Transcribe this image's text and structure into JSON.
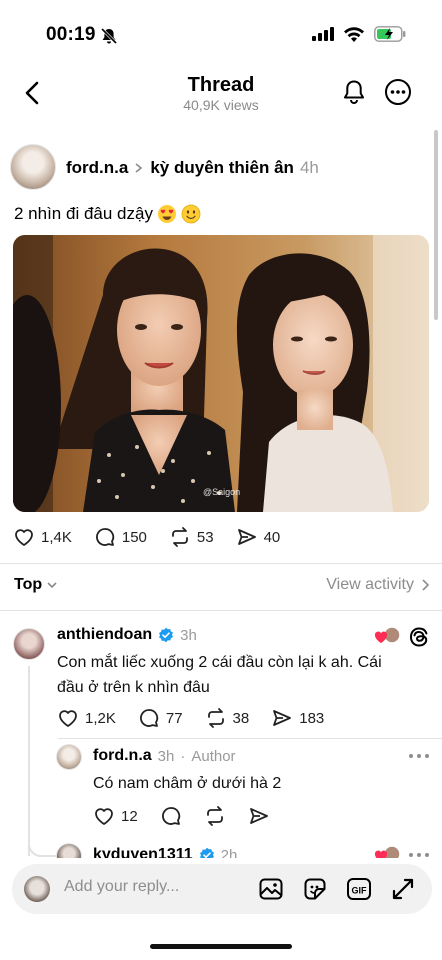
{
  "status": {
    "time": "00:19"
  },
  "header": {
    "title": "Thread",
    "views": "40,9K views"
  },
  "post": {
    "username": "ford.n.a",
    "reply_to": "kỳ duyên thiên ân",
    "time": "4h",
    "text": "2 nhìn đi đâu dzậy",
    "image_watermark": "@Saigon",
    "likes": "1,4K",
    "comments": "150",
    "reposts": "53",
    "shares": "40"
  },
  "sort": {
    "label": "Top",
    "view_activity": "View activity"
  },
  "comments": [
    {
      "username": "anthiendoan",
      "time": "3h",
      "text_line1": "Con mắt liếc xuống 2 cái đầu còn lại k ah. Cái",
      "text_line2": "đầu ở trên k nhìn đâu",
      "likes": "1,2K",
      "comments": "77",
      "reposts": "38",
      "shares": "183"
    }
  ],
  "replies": [
    {
      "username": "ford.n.a",
      "time": "3h",
      "tag": "Author",
      "text": "Có nam châm ở dưới hà 2",
      "likes": "12"
    },
    {
      "username": "kyduyen1311",
      "time": "2h"
    }
  ],
  "reply_bar": {
    "placeholder": "Add your reply..."
  },
  "colors": {
    "verified": "#1d9bf0",
    "heart": "#ff2d55",
    "muted": "#8e8e8e"
  }
}
